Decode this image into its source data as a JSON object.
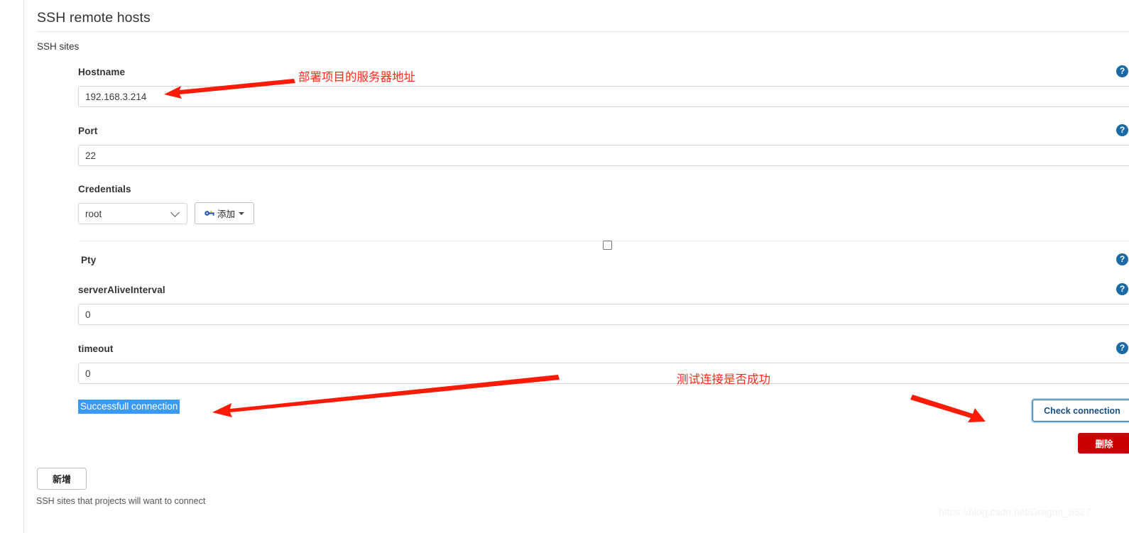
{
  "section": {
    "title": "SSH remote hosts",
    "sites_label": "SSH sites",
    "footer_help": "SSH sites that projects will want to connect"
  },
  "fields": {
    "hostname": {
      "label": "Hostname",
      "value": "192.168.3.214",
      "placeholder": ""
    },
    "port": {
      "label": "Port",
      "value": "22",
      "placeholder": ""
    },
    "credentials": {
      "label": "Credentials",
      "value": "root"
    },
    "pty": {
      "label": "Pty",
      "checked": false
    },
    "server_alive_interval": {
      "label": "serverAliveInterval",
      "value": "0",
      "placeholder": ""
    },
    "timeout": {
      "label": "timeout",
      "value": "0",
      "placeholder": ""
    }
  },
  "buttons": {
    "add_credentials": "添加",
    "check_connection": "Check connection",
    "delete": "删除",
    "add_site": "新增"
  },
  "status": {
    "connection_result": "Successfull connection"
  },
  "icons": {
    "help": "?",
    "key": "key-icon",
    "caret_down": "chevron-down-icon"
  },
  "annotations": {
    "hostname_note": "部署项目的服务器地址",
    "check_note": "测试连接是否成功"
  },
  "watermark": "https://blog.csdn.net/Dragon_9527",
  "colors": {
    "help_blue": "#1b6aa5",
    "selection_blue": "#3a9afc",
    "delete_red": "#cc0000",
    "annotation_red": "#ff2c18",
    "focus_ring": "#5e9ed6"
  }
}
